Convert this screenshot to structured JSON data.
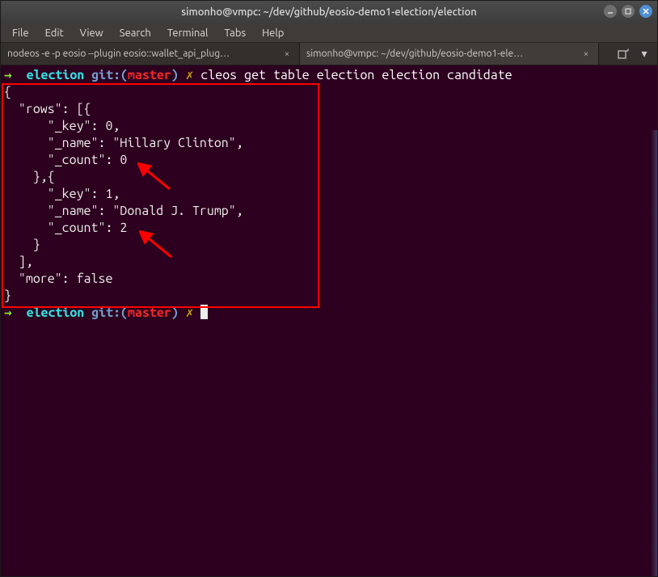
{
  "titlebar": {
    "title": "simonho@vmpc: ~/dev/github/eosio-demo1-election/election"
  },
  "menubar": {
    "items": [
      "File",
      "Edit",
      "View",
      "Search",
      "Terminal",
      "Tabs",
      "Help"
    ]
  },
  "tabs": [
    {
      "label": "nodeos -e -p eosio --plugin eosio::wallet_api_plug…",
      "active": false
    },
    {
      "label": "simonho@vmpc: ~/dev/github/eosio-demo1-ele…",
      "active": true
    }
  ],
  "prompt1": {
    "arrow": "→",
    "dir": "election",
    "gitword": "git:",
    "branch_open": "(",
    "branch": "master",
    "branch_close": ")",
    "x": "✗",
    "command": "cleos get table election election candidate"
  },
  "output_lines": [
    "{",
    "  \"rows\": [{",
    "      \"_key\": 0,",
    "      \"_name\": \"Hillary Clinton\",",
    "      \"_count\": 0",
    "    },{",
    "      \"_key\": 1,",
    "      \"_name\": \"Donald J. Trump\",",
    "      \"_count\": 2",
    "    }",
    "  ],",
    "  \"more\": false",
    "}"
  ],
  "prompt2": {
    "arrow": "→",
    "dir": "election",
    "gitword": "git:",
    "branch_open": "(",
    "branch": "master",
    "branch_close": ")",
    "x": "✗"
  },
  "table_data": {
    "rows": [
      {
        "_key": 0,
        "_name": "Hillary Clinton",
        "_count": 0
      },
      {
        "_key": 1,
        "_name": "Donald J. Trump",
        "_count": 2
      }
    ],
    "more": false
  },
  "icons": {
    "close": "×",
    "newtab": "⊕",
    "menu": "▾"
  }
}
